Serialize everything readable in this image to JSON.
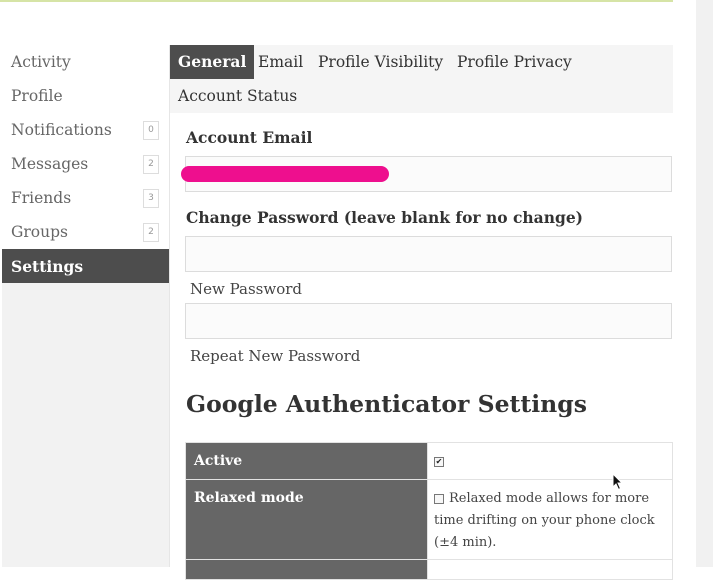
{
  "sidebar": {
    "items": [
      {
        "label": "Activity",
        "count": null
      },
      {
        "label": "Profile",
        "count": null
      },
      {
        "label": "Notifications",
        "count": "0"
      },
      {
        "label": "Messages",
        "count": "2"
      },
      {
        "label": "Friends",
        "count": "3"
      },
      {
        "label": "Groups",
        "count": "2"
      },
      {
        "label": "Settings",
        "count": null,
        "active": true
      }
    ]
  },
  "tabs": [
    {
      "label": "General",
      "active": true
    },
    {
      "label": "Email"
    },
    {
      "label": "Profile Visibility"
    },
    {
      "label": "Profile Privacy"
    },
    {
      "label": "Account Status"
    }
  ],
  "form": {
    "account_email_label": "Account Email",
    "account_email_value": "",
    "change_password_label": "Change Password (leave blank for no change)",
    "new_password_hint": "New Password",
    "repeat_password_hint": "Repeat New Password"
  },
  "google_auth": {
    "title": "Google Authenticator Settings",
    "rows": [
      {
        "key": "Active",
        "checked": true,
        "description": ""
      },
      {
        "key": "Relaxed mode",
        "checked": false,
        "description": "Relaxed mode allows for more time drifting on your phone clock (±4 min)."
      }
    ]
  },
  "colors": {
    "active_tab": "#4d4d4d",
    "table_key_bg": "#666666",
    "redaction": "#ee0f8e",
    "top_bar": "#d6e4a6"
  }
}
